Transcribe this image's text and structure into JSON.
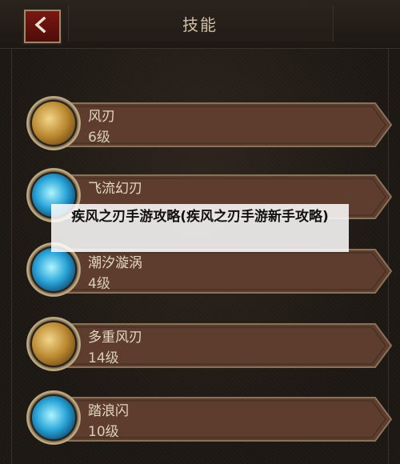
{
  "header": {
    "title": "技能"
  },
  "skills": [
    {
      "name": "风刃",
      "level": "6级",
      "element": "gold"
    },
    {
      "name": "飞流幻刃",
      "level": "",
      "element": "blue"
    },
    {
      "name": "潮汐漩涡",
      "level": "4级",
      "element": "blue"
    },
    {
      "name": "多重风刃",
      "level": "14级",
      "element": "gold"
    },
    {
      "name": "踏浪闪",
      "level": "10级",
      "element": "blue"
    }
  ],
  "overlay": {
    "caption": "疾风之刃手游攻略(疾风之刃手游新手攻略)"
  },
  "colors": {
    "accent_red": "#7a1712",
    "bar_brown": "#5e3d2f",
    "text": "#e3d7c0"
  }
}
